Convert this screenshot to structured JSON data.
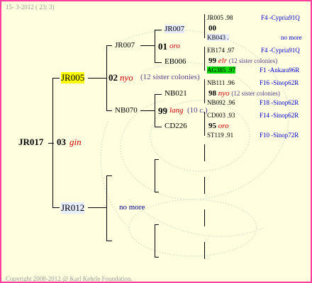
{
  "header": {
    "date": "15-  3-2012 ( 23:  3)"
  },
  "footer": {
    "copyright": "Copyright 2008-2012 @ Karl Kehrle Foundation."
  },
  "root": {
    "id": "JR017",
    "gen": "03",
    "name": "gin"
  },
  "parents": {
    "father": {
      "id": "JR005"
    },
    "mother": {
      "id": "JR012",
      "note": "no more"
    }
  },
  "gen2": {
    "sire_of_father": {
      "id": "JR007"
    },
    "dam_of_father": {
      "id": "NB070"
    },
    "father_gen": "02",
    "father_name": "nyo",
    "father_sisters": "(12 sister colonies)"
  },
  "gen3": {
    "a": {
      "id": "JR007",
      "gen": "01",
      "name": "oro"
    },
    "b": {
      "id": "EB006"
    },
    "c": {
      "id": "NB021",
      "gen": "99",
      "name": "lang",
      "extra": "(10 c.)"
    },
    "d": {
      "id": "CD226"
    }
  },
  "gen4": [
    {
      "id": "JR005",
      "year": ".98",
      "loc": "F4 -Cypria91Q"
    },
    {
      "id": "00",
      "year": "",
      "loc": ""
    },
    {
      "id": "KB043",
      "year": ".",
      "loc": "no more"
    },
    {
      "id": "EB174",
      "year": ".97",
      "loc": "F4 -Cypria91Q"
    },
    {
      "id": "99",
      "name": "elr",
      "extra": "(12 sister colonies)"
    },
    {
      "id": "AG385",
      "year": ".97",
      "loc": "F1 -Ankara96R"
    },
    {
      "id": "NB111",
      "year": ".96",
      "loc": "F16 -Sinop62R"
    },
    {
      "id": "98",
      "name": "nyo",
      "extra": "(12 sister colonies)"
    },
    {
      "id": "NB092",
      "year": ".96",
      "loc": "F18 -Sinop62R"
    },
    {
      "id": "CD003",
      "year": ".93",
      "loc": "F14 -Sinop62R"
    },
    {
      "id": "95",
      "name": "oro"
    },
    {
      "id": "ST119",
      "year": ".91",
      "loc": "F10 -Sinop72R"
    }
  ]
}
